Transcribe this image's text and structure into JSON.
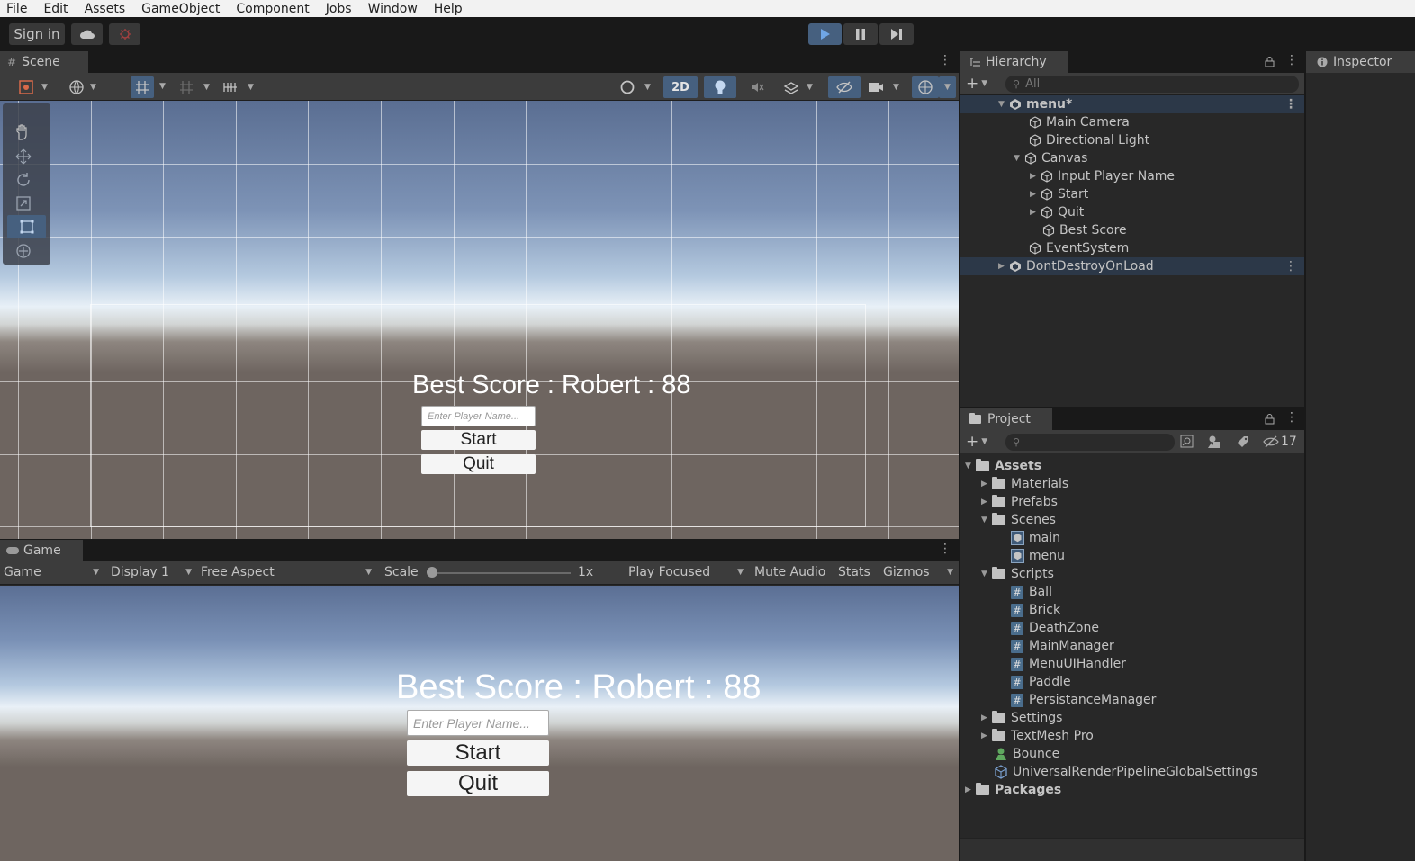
{
  "menubar": [
    "File",
    "Edit",
    "Assets",
    "GameObject",
    "Component",
    "Jobs",
    "Window",
    "Help"
  ],
  "toolbar": {
    "sign_in": "Sign in"
  },
  "scene": {
    "tab": "Scene",
    "mode_2d": "2D",
    "best_score": "Best Score : Robert : 88",
    "placeholder": "Enter Player Name...",
    "start": "Start",
    "quit": "Quit"
  },
  "game": {
    "tab": "Game",
    "view": "Game",
    "display": "Display 1",
    "aspect": "Free Aspect",
    "scale_label": "Scale",
    "scale_value": "1x",
    "play_focused": "Play Focused",
    "mute": "Mute Audio",
    "stats": "Stats",
    "gizmos": "Gizmos",
    "best_score": "Best Score : Robert : 88",
    "placeholder": "Enter Player Name...",
    "start": "Start",
    "quit": "Quit"
  },
  "hierarchy": {
    "tab": "Hierarchy",
    "search_placeholder": "All",
    "items": [
      {
        "label": "menu*"
      },
      {
        "label": "Main Camera"
      },
      {
        "label": "Directional Light"
      },
      {
        "label": "Canvas"
      },
      {
        "label": "Input Player Name"
      },
      {
        "label": "Start"
      },
      {
        "label": "Quit"
      },
      {
        "label": "Best Score"
      },
      {
        "label": "EventSystem"
      },
      {
        "label": "DontDestroyOnLoad"
      }
    ]
  },
  "inspector": {
    "tab": "Inspector"
  },
  "project": {
    "tab": "Project",
    "hidden_count": "17",
    "items": [
      {
        "label": "Assets"
      },
      {
        "label": "Materials"
      },
      {
        "label": "Prefabs"
      },
      {
        "label": "Scenes"
      },
      {
        "label": "main"
      },
      {
        "label": "menu"
      },
      {
        "label": "Scripts"
      },
      {
        "label": "Ball"
      },
      {
        "label": "Brick"
      },
      {
        "label": "DeathZone"
      },
      {
        "label": "MainManager"
      },
      {
        "label": "MenuUIHandler"
      },
      {
        "label": "Paddle"
      },
      {
        "label": "PersistanceManager"
      },
      {
        "label": "Settings"
      },
      {
        "label": "TextMesh Pro"
      },
      {
        "label": "Bounce"
      },
      {
        "label": "UniversalRenderPipelineGlobalSettings"
      },
      {
        "label": "Packages"
      }
    ]
  },
  "colors": {
    "accent": "#3a79bb",
    "selected_row": "#2c3848",
    "sky_top": "#5a6e92",
    "ground": "#6e6560"
  }
}
